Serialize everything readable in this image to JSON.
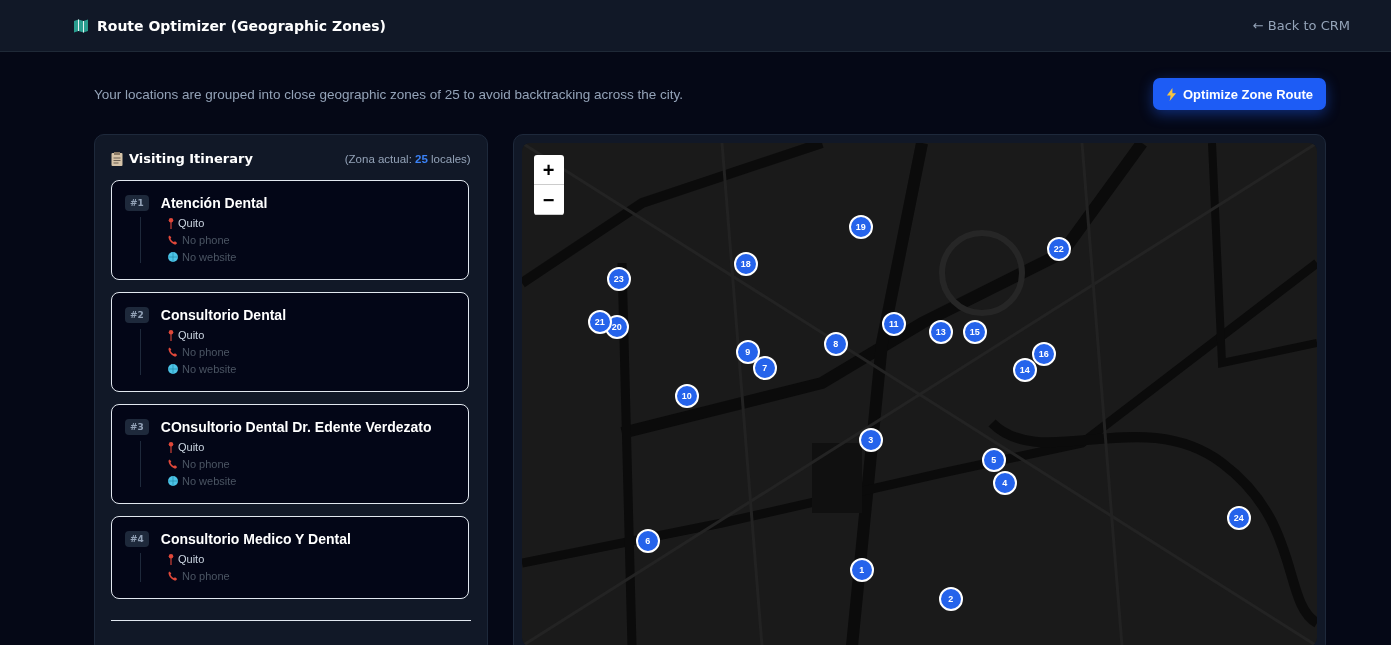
{
  "header": {
    "title": "Route Optimizer (Geographic Zones)",
    "back_link": "← Back to CRM"
  },
  "intro": "Your locations are grouped into close geographic zones of 25 to avoid backtracking across the city.",
  "optimize_button": "Optimize Zone Route",
  "itinerary": {
    "title": "Visiting Itinerary",
    "zone_prefix": "(Zona actual: ",
    "zone_count": "25",
    "zone_suffix": " locales)",
    "stops": [
      {
        "number": "#1",
        "name": "Atención Dental",
        "details": [
          {
            "kind": "address",
            "text": "Quito"
          },
          {
            "kind": "phone",
            "text": "No phone"
          },
          {
            "kind": "website",
            "text": "No website"
          }
        ]
      },
      {
        "number": "#2",
        "name": "Consultorio Dental",
        "details": [
          {
            "kind": "address",
            "text": "Quito"
          },
          {
            "kind": "phone",
            "text": "No phone"
          },
          {
            "kind": "website",
            "text": "No website"
          }
        ]
      },
      {
        "number": "#3",
        "name": "COnsultorio Dental Dr. Edente Verdezato",
        "details": [
          {
            "kind": "address",
            "text": "Quito"
          },
          {
            "kind": "phone",
            "text": "No phone"
          },
          {
            "kind": "website",
            "text": "No website"
          }
        ]
      },
      {
        "number": "#4",
        "name": "Consultorio Medico Y Dental",
        "details": [
          {
            "kind": "address",
            "text": "Quito"
          },
          {
            "kind": "phone",
            "text": "No phone"
          }
        ]
      }
    ]
  },
  "map": {
    "zoom_in": "+",
    "zoom_out": "−",
    "markers": [
      "1",
      "2",
      "3",
      "4",
      "5",
      "6",
      "7",
      "8",
      "9",
      "10",
      "11",
      "13",
      "14",
      "15",
      "16",
      "18",
      "19",
      "20",
      "21",
      "22",
      "23",
      "24"
    ]
  }
}
